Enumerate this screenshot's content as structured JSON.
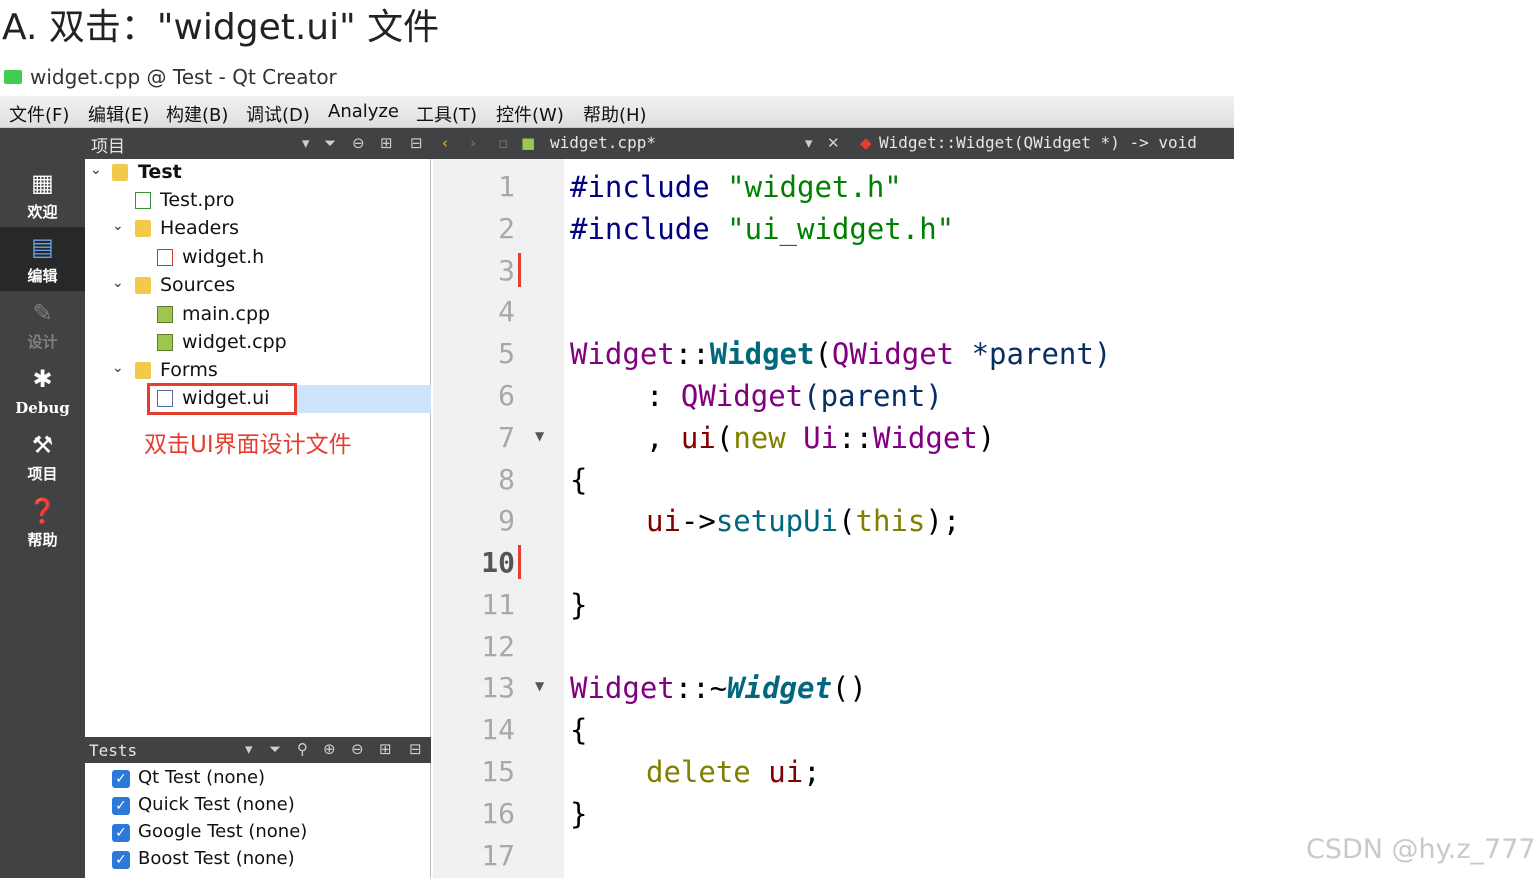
{
  "heading": "A. 双击：\"widget.ui\" 文件",
  "window": {
    "title": "widget.cpp @ Test - Qt Creator"
  },
  "menubar": {
    "items": [
      "文件(F)",
      "编辑(E)",
      "构建(B)",
      "调试(D)",
      "Analyze",
      "工具(T)",
      "控件(W)",
      "帮助(H)"
    ]
  },
  "toolbar": {
    "pane_title": "项目",
    "file_name": "widget.cpp*",
    "symbol": "Widget::Widget(QWidget *) -> void"
  },
  "modes": [
    {
      "label": "欢迎",
      "icon": "grid-icon"
    },
    {
      "label": "编辑",
      "icon": "document-icon"
    },
    {
      "label": "设计",
      "icon": "pencil-icon"
    },
    {
      "label": "Debug",
      "icon": "bug-icon"
    },
    {
      "label": "项目",
      "icon": "wrench-icon"
    },
    {
      "label": "帮助",
      "icon": "help-icon"
    }
  ],
  "project_tree": {
    "root": "Test",
    "pro_file": "Test.pro",
    "headers": "Headers",
    "header_file": "widget.h",
    "sources": "Sources",
    "source_main": "main.cpp",
    "source_widget": "widget.cpp",
    "forms": "Forms",
    "form_file": "widget.ui"
  },
  "annotation": "双击UI界面设计文件",
  "tests": {
    "title": "Tests",
    "items": [
      "Qt Test (none)",
      "Quick Test (none)",
      "Google Test (none)",
      "Boost Test (none)"
    ]
  },
  "editor": {
    "line_numbers": [
      "1",
      "2",
      "3",
      "4",
      "5",
      "6",
      "7",
      "8",
      "9",
      "10",
      "11",
      "12",
      "13",
      "14",
      "15",
      "16",
      "17"
    ],
    "current_line": 10,
    "code": {
      "l1_kw": "#include",
      "l1_str": "\"widget.h\"",
      "l2_kw": "#include",
      "l2_str": "\"ui_widget.h\"",
      "l5_class": "Widget",
      "l5_sep": "::",
      "l5_fn": "Widget",
      "l5_open": "(",
      "l5_type": "QWidget",
      "l5_rest": " *parent)",
      "l6_colon": ": ",
      "l6_type": "QWidget",
      "l6_rest": "(parent)",
      "l7_comma": ", ",
      "l7_member": "ui",
      "l7_open": "(",
      "l7_new": "new",
      "l7_sp": " ",
      "l7_ns": "Ui",
      "l7_sep": "::",
      "l7_type": "Widget",
      "l7_close": ")",
      "l8": "{",
      "l9_member": "ui",
      "l9_arrow": "->",
      "l9_fn": "setupUi",
      "l9_open": "(",
      "l9_this": "this",
      "l9_close": ");",
      "l11": "}",
      "l13_class": "Widget",
      "l13_sep": "::~",
      "l13_fn": "Widget",
      "l13_paren": "()",
      "l14": "{",
      "l15_kw": "delete",
      "l15_sp": " ",
      "l15_member": "ui",
      "l15_semi": ";",
      "l16": "}"
    }
  },
  "watermark": "CSDN @hy.z_777"
}
